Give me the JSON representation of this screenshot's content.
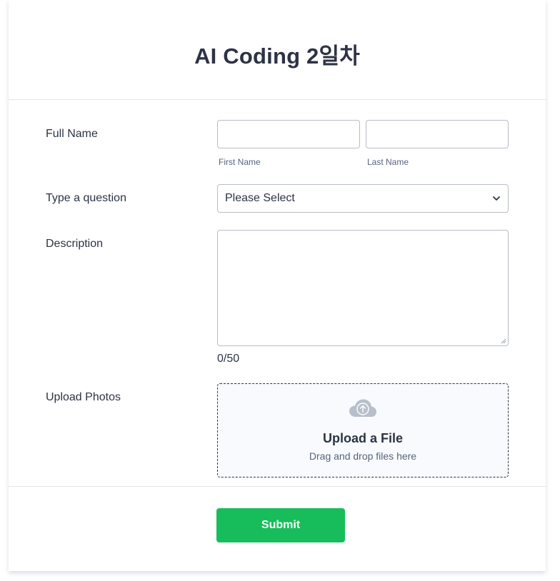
{
  "form": {
    "title": "AI Coding 2일차"
  },
  "full_name": {
    "label": "Full Name",
    "first_value": "",
    "last_value": "",
    "first_sublabel": "First Name",
    "last_sublabel": "Last Name"
  },
  "question": {
    "label": "Type a question",
    "selected": "Please Select",
    "chevron_icon": "chevron-down-icon"
  },
  "description": {
    "label": "Description",
    "value": "",
    "counter": "0/50"
  },
  "upload": {
    "label": "Upload Photos",
    "icon": "cloud-upload-icon",
    "title": "Upload a File",
    "subtitle": "Drag and drop files here"
  },
  "submit": {
    "label": "Submit"
  },
  "colors": {
    "submit_bg": "#18bd5b",
    "text": "#2c3345",
    "muted": "#57647e",
    "border": "#b8bdc9",
    "upload_bg": "#f8fafd"
  }
}
